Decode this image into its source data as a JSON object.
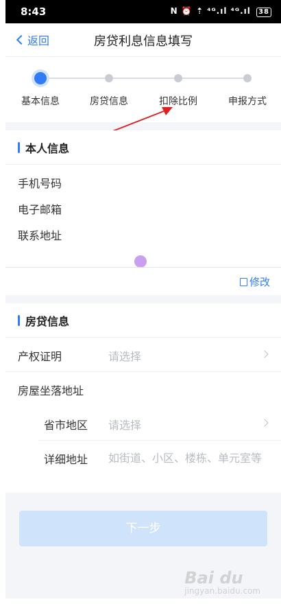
{
  "status_bar": {
    "time": "8:43",
    "icons": "N ⏰ ⇡ ⁴ᴳ.ıl ⁴ᴳ.ıl",
    "battery": "38"
  },
  "nav": {
    "back_label": "返回",
    "title": "房贷利息信息填写"
  },
  "steps": [
    {
      "label": "基本信息",
      "active": true
    },
    {
      "label": "房贷信息",
      "active": false
    },
    {
      "label": "扣除比例",
      "active": false
    },
    {
      "label": "申报方式",
      "active": false
    }
  ],
  "personal_info": {
    "title": "本人信息",
    "fields": [
      "手机号码",
      "电子邮箱",
      "联系地址"
    ],
    "modify_label": "修改"
  },
  "loan_info": {
    "title": "房贷信息",
    "property_cert": {
      "label": "产权证明",
      "placeholder": "请选择"
    },
    "house_address": {
      "label": "房屋坐落地址"
    },
    "region": {
      "label": "省市地区",
      "placeholder": "请选择"
    },
    "detail_address": {
      "label": "详细地址",
      "placeholder": "如街道、小区、楼栋、单元室等"
    }
  },
  "next_button": {
    "label": "下一步"
  },
  "watermark": {
    "text": "Bai du",
    "sub": "jingyan.baidu.com"
  },
  "colors": {
    "accent": "#2f7cf6",
    "button_disabled": "#cfe4fb",
    "annotation_arrow": "#e02020"
  }
}
